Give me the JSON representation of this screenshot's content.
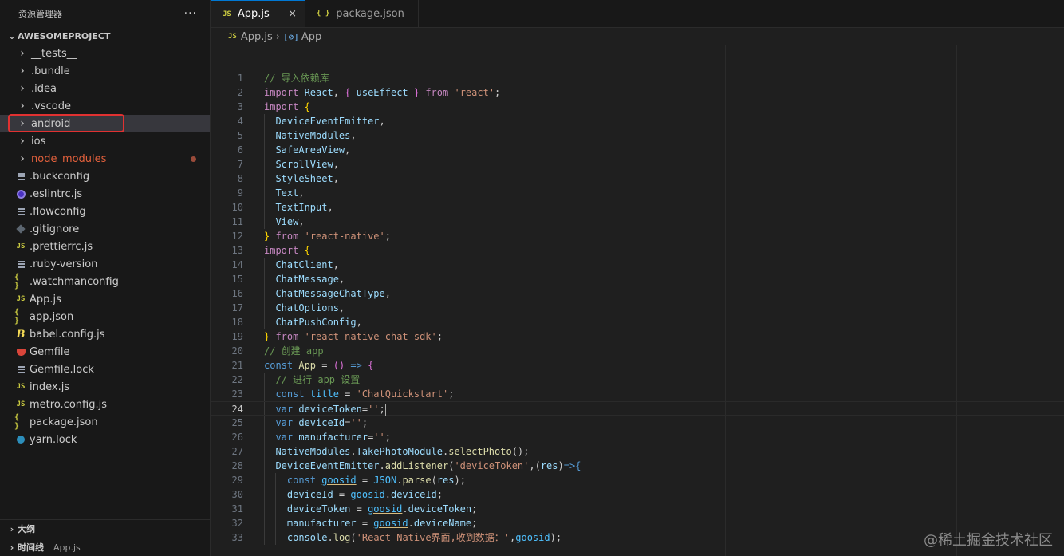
{
  "sidebar": {
    "title": "资源管理器",
    "more": "···",
    "project": "AWESOMEPROJECT",
    "items": [
      {
        "label": "__tests__",
        "kind": "folder"
      },
      {
        "label": ".bundle",
        "kind": "folder"
      },
      {
        "label": ".idea",
        "kind": "folder"
      },
      {
        "label": ".vscode",
        "kind": "folder"
      },
      {
        "label": "android",
        "kind": "folder",
        "selected": true
      },
      {
        "label": "ios",
        "kind": "folder"
      },
      {
        "label": "node_modules",
        "kind": "folder",
        "modified": true
      },
      {
        "label": ".buckconfig",
        "kind": "file",
        "icon": "lines-icon"
      },
      {
        "label": ".eslintrc.js",
        "kind": "file",
        "icon": "eslint-icon"
      },
      {
        "label": ".flowconfig",
        "kind": "file",
        "icon": "lines-icon"
      },
      {
        "label": ".gitignore",
        "kind": "file",
        "icon": "git-icon"
      },
      {
        "label": ".prettierrc.js",
        "kind": "file",
        "icon": "js-icon"
      },
      {
        "label": ".ruby-version",
        "kind": "file",
        "icon": "lines-icon"
      },
      {
        "label": ".watchmanconfig",
        "kind": "file",
        "icon": "json-icon"
      },
      {
        "label": "App.js",
        "kind": "file",
        "icon": "js-icon"
      },
      {
        "label": "app.json",
        "kind": "file",
        "icon": "json-icon"
      },
      {
        "label": "babel.config.js",
        "kind": "file",
        "icon": "babel-icon"
      },
      {
        "label": "Gemfile",
        "kind": "file",
        "icon": "ruby-icon"
      },
      {
        "label": "Gemfile.lock",
        "kind": "file",
        "icon": "lines-icon"
      },
      {
        "label": "index.js",
        "kind": "file",
        "icon": "js-icon"
      },
      {
        "label": "metro.config.js",
        "kind": "file",
        "icon": "js-icon"
      },
      {
        "label": "package.json",
        "kind": "file",
        "icon": "json-icon"
      },
      {
        "label": "yarn.lock",
        "kind": "file",
        "icon": "yarn-icon"
      }
    ],
    "outline": "大纲",
    "timeline": "时间线",
    "timeline_file": "App.js"
  },
  "tabs": [
    {
      "label": "App.js",
      "icon": "JS",
      "active": true,
      "close": "×"
    },
    {
      "label": "package.json",
      "icon": "{ }",
      "active": false
    }
  ],
  "breadcrumb": {
    "file": "App.js",
    "file_icon": "JS",
    "symbol": "App",
    "symbol_icon": "[⊘]",
    "sep": "›"
  },
  "editor": {
    "current_line": 24,
    "lines": [
      [
        {
          "t": "// 导入依赖库",
          "c": "cmt"
        }
      ],
      [
        {
          "t": "import ",
          "c": "kw"
        },
        {
          "t": "React",
          "c": "vr"
        },
        {
          "t": ", "
        },
        {
          "t": "{",
          "c": "br2"
        },
        {
          "t": " useEffect ",
          "c": "vr"
        },
        {
          "t": "}",
          "c": "br2"
        },
        {
          "t": " from ",
          "c": "kw"
        },
        {
          "t": "'react'",
          "c": "str"
        },
        {
          "t": ";"
        }
      ],
      [
        {
          "t": "import ",
          "c": "kw"
        },
        {
          "t": "{",
          "c": "br"
        }
      ],
      [
        {
          "t": "  DeviceEventEmitter",
          "c": "vr"
        },
        {
          "t": ","
        }
      ],
      [
        {
          "t": "  NativeModules",
          "c": "vr"
        },
        {
          "t": ","
        }
      ],
      [
        {
          "t": "  SafeAreaView",
          "c": "vr"
        },
        {
          "t": ","
        }
      ],
      [
        {
          "t": "  ScrollView",
          "c": "vr"
        },
        {
          "t": ","
        }
      ],
      [
        {
          "t": "  StyleSheet",
          "c": "vr"
        },
        {
          "t": ","
        }
      ],
      [
        {
          "t": "  Text",
          "c": "vr"
        },
        {
          "t": ","
        }
      ],
      [
        {
          "t": "  TextInput",
          "c": "vr"
        },
        {
          "t": ","
        }
      ],
      [
        {
          "t": "  View",
          "c": "vr"
        },
        {
          "t": ","
        }
      ],
      [
        {
          "t": "}",
          "c": "br"
        },
        {
          "t": " from ",
          "c": "kw"
        },
        {
          "t": "'react-native'",
          "c": "str"
        },
        {
          "t": ";"
        }
      ],
      [
        {
          "t": "import ",
          "c": "kw"
        },
        {
          "t": "{",
          "c": "br"
        }
      ],
      [
        {
          "t": "  ChatClient",
          "c": "vr"
        },
        {
          "t": ","
        }
      ],
      [
        {
          "t": "  ChatMessage",
          "c": "vr"
        },
        {
          "t": ","
        }
      ],
      [
        {
          "t": "  ChatMessageChatType",
          "c": "vr"
        },
        {
          "t": ","
        }
      ],
      [
        {
          "t": "  ChatOptions",
          "c": "vr"
        },
        {
          "t": ","
        }
      ],
      [
        {
          "t": "  ChatPushConfig",
          "c": "vr"
        },
        {
          "t": ","
        }
      ],
      [
        {
          "t": "}",
          "c": "br"
        },
        {
          "t": " from ",
          "c": "kw"
        },
        {
          "t": "'react-native-chat-sdk'",
          "c": "str"
        },
        {
          "t": ";"
        }
      ],
      [
        {
          "t": "// 创建 app",
          "c": "cmt"
        }
      ],
      [
        {
          "t": "const ",
          "c": "kw2"
        },
        {
          "t": "App",
          "c": "fn"
        },
        {
          "t": " = "
        },
        {
          "t": "()",
          "c": "br2"
        },
        {
          "t": " => ",
          "c": "kw2"
        },
        {
          "t": "{",
          "c": "br2"
        }
      ],
      [
        {
          "t": "  // 进行 app 设置",
          "c": "cmt"
        }
      ],
      [
        {
          "t": "  const ",
          "c": "kw2"
        },
        {
          "t": "title",
          "c": "cv"
        },
        {
          "t": " = "
        },
        {
          "t": "'ChatQuickstart'",
          "c": "str"
        },
        {
          "t": ";"
        }
      ],
      [
        {
          "t": "  var ",
          "c": "kw2"
        },
        {
          "t": "deviceToken",
          "c": "vr"
        },
        {
          "t": "="
        },
        {
          "t": "''",
          "c": "str"
        },
        {
          "t": ";"
        }
      ],
      [
        {
          "t": "  var ",
          "c": "kw2"
        },
        {
          "t": "deviceId",
          "c": "vr"
        },
        {
          "t": "="
        },
        {
          "t": "''",
          "c": "str"
        },
        {
          "t": ";"
        }
      ],
      [
        {
          "t": "  var ",
          "c": "kw2"
        },
        {
          "t": "manufacturer",
          "c": "vr"
        },
        {
          "t": "="
        },
        {
          "t": "''",
          "c": "str"
        },
        {
          "t": ";"
        }
      ],
      [
        {
          "t": "  NativeModules",
          "c": "vr"
        },
        {
          "t": "."
        },
        {
          "t": "TakePhotoModule",
          "c": "vr"
        },
        {
          "t": "."
        },
        {
          "t": "selectPhoto",
          "c": "fn"
        },
        {
          "t": "();"
        }
      ],
      [
        {
          "t": "  DeviceEventEmitter",
          "c": "vr"
        },
        {
          "t": "."
        },
        {
          "t": "addListener",
          "c": "fn"
        },
        {
          "t": "("
        },
        {
          "t": "'deviceToken'",
          "c": "str"
        },
        {
          "t": ",("
        },
        {
          "t": "res",
          "c": "vr"
        },
        {
          "t": ")"
        },
        {
          "t": "=>",
          "c": "kw2"
        },
        {
          "t": "{",
          "c": "kw2"
        }
      ],
      [
        {
          "t": "    const ",
          "c": "kw2"
        },
        {
          "t": "goosid",
          "c": "cv ul"
        },
        {
          "t": " = "
        },
        {
          "t": "JSON",
          "c": "cv"
        },
        {
          "t": "."
        },
        {
          "t": "parse",
          "c": "fn"
        },
        {
          "t": "("
        },
        {
          "t": "res",
          "c": "vr"
        },
        {
          "t": ");"
        }
      ],
      [
        {
          "t": "    deviceId",
          "c": "vr"
        },
        {
          "t": " = "
        },
        {
          "t": "goosid",
          "c": "cv ul"
        },
        {
          "t": "."
        },
        {
          "t": "deviceId",
          "c": "vr"
        },
        {
          "t": ";"
        }
      ],
      [
        {
          "t": "    deviceToken",
          "c": "vr"
        },
        {
          "t": " = "
        },
        {
          "t": "goosid",
          "c": "cv ul"
        },
        {
          "t": "."
        },
        {
          "t": "deviceToken",
          "c": "vr"
        },
        {
          "t": ";"
        }
      ],
      [
        {
          "t": "    manufacturer",
          "c": "vr"
        },
        {
          "t": " = "
        },
        {
          "t": "goosid",
          "c": "cv ul"
        },
        {
          "t": "."
        },
        {
          "t": "deviceName",
          "c": "vr"
        },
        {
          "t": ";"
        }
      ],
      [
        {
          "t": "    console",
          "c": "vr"
        },
        {
          "t": "."
        },
        {
          "t": "log",
          "c": "fn"
        },
        {
          "t": "("
        },
        {
          "t": "'React Native界面,收到数据：'",
          "c": "str"
        },
        {
          "t": ","
        },
        {
          "t": "goosid",
          "c": "cv ul"
        },
        {
          "t": ");"
        }
      ]
    ]
  },
  "watermark": "@稀土掘金技术社区"
}
